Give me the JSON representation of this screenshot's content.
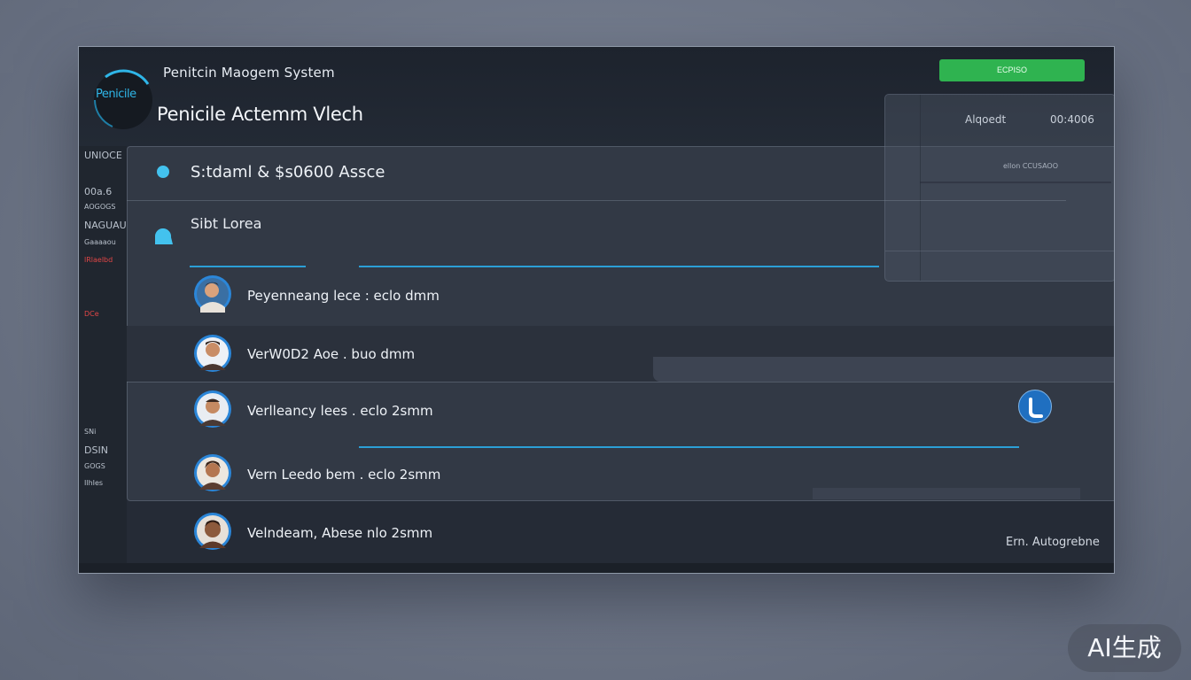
{
  "header": {
    "logo_text": "Penicile",
    "app_title": "Penitcin Maogem System",
    "view_title": "Penicile Actemm Vlech",
    "action_button": "ECPISO"
  },
  "side_panel": {
    "meta_left": "Alqoedt",
    "meta_right": "00:4006",
    "meta_note": "ellon CCUSAOO"
  },
  "left_nav": {
    "items": [
      "UNIOCE",
      "00a.6",
      "AOGOGS",
      "NAGUAU",
      "Gaaaaou",
      "lRlaelbd",
      "DCe",
      "SNi",
      "DSIN",
      "GOGS",
      "IlhIes"
    ]
  },
  "rows": {
    "system": "S:tdaml & $s0600 Assce",
    "section": "Sibt Lorea"
  },
  "people": [
    {
      "label": "Peyenneang lece : eclo dmm"
    },
    {
      "label": "VerW0D2 Aoe . buo dmm"
    },
    {
      "label": "Verlleancy lees . eclo 2smm"
    },
    {
      "label": "Vern Leedo bem . eclo 2smm"
    },
    {
      "label": "Velndeam, Abese nlo 2smm"
    }
  ],
  "footer": {
    "status": "Ern. Autogrebne"
  },
  "watermark": "AI生成",
  "colors": {
    "accent": "#2b9fd6",
    "green": "#2fb350",
    "red": "#e04646",
    "dot": "#43c2ee"
  }
}
